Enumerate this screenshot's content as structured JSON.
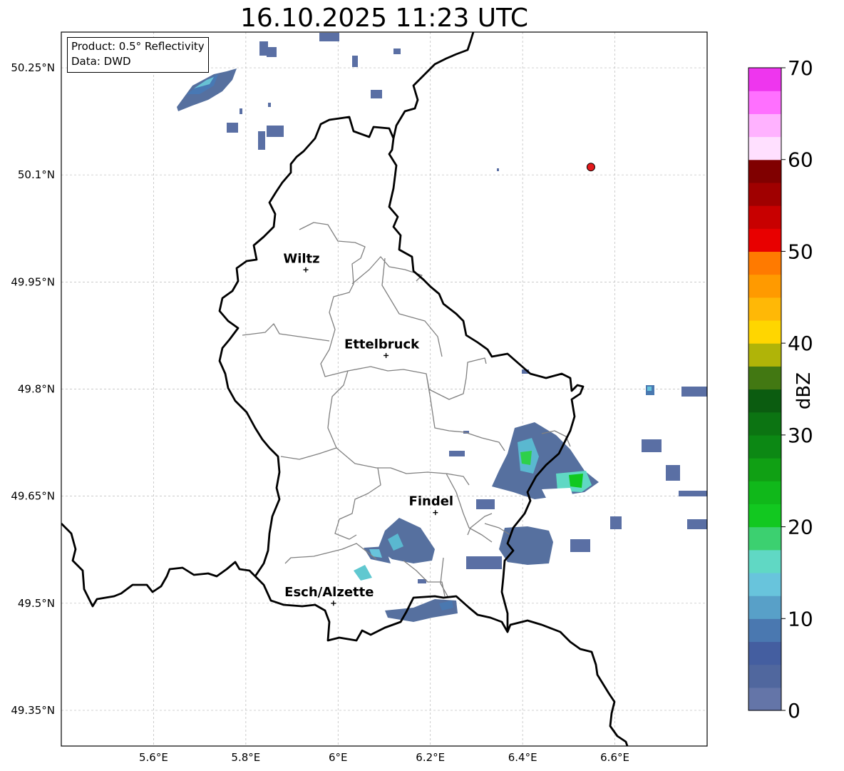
{
  "title": "16.10.2025 11:23 UTC",
  "info": {
    "product": "Product: 0.5° Reflectivity",
    "data": "Data: DWD"
  },
  "map": {
    "lon_range": [
      5.4,
      6.8
    ],
    "lat_range": [
      49.3,
      50.3
    ],
    "lon_ticks": [
      {
        "value": 5.6,
        "label": "5.6°E"
      },
      {
        "value": 5.8,
        "label": "5.8°E"
      },
      {
        "value": 6.0,
        "label": "6°E"
      },
      {
        "value": 6.2,
        "label": "6.2°E"
      },
      {
        "value": 6.4,
        "label": "6.4°E"
      },
      {
        "value": 6.6,
        "label": "6.6°E"
      }
    ],
    "lat_ticks": [
      {
        "value": 49.35,
        "label": "49.35°N"
      },
      {
        "value": 49.5,
        "label": "49.5°N"
      },
      {
        "value": 49.65,
        "label": "49.65°N"
      },
      {
        "value": 49.8,
        "label": "49.8°N"
      },
      {
        "value": 49.95,
        "label": "49.95°N"
      },
      {
        "value": 50.1,
        "label": "50.1°N"
      },
      {
        "value": 50.25,
        "label": "50.25°N"
      }
    ],
    "grid": true,
    "cities": [
      {
        "name": "Wiltz",
        "lon": 5.93,
        "lat": 49.967
      },
      {
        "name": "Ettelbruck",
        "lon": 6.104,
        "lat": 49.847
      },
      {
        "name": "Findel",
        "lon": 6.211,
        "lat": 49.627
      },
      {
        "name": "Esch/Alzette",
        "lon": 5.99,
        "lat": 49.5
      }
    ],
    "radar_site": {
      "lon": 6.548,
      "lat": 50.111,
      "color": "#e41a1c"
    }
  },
  "colorbar": {
    "unit": "dBZ",
    "min": 0,
    "max": 70,
    "tick_labels": [
      "0",
      "10",
      "20",
      "30",
      "40",
      "50",
      "60",
      "70"
    ],
    "colors": [
      "#6475a8",
      "#50679e",
      "#445ea0",
      "#4a78b0",
      "#58a0c8",
      "#68c4dc",
      "#60d8c4",
      "#3cd070",
      "#12c820",
      "#10b81a",
      "#10a014",
      "#0c8814",
      "#0c7412",
      "#0b5c10",
      "#427812",
      "#b0b408",
      "#ffd600",
      "#ffb806",
      "#ff9a00",
      "#ff7a00",
      "#e80000",
      "#c80000",
      "#a00000",
      "#800000",
      "#ffe0ff",
      "#ffb2ff",
      "#ff70ff",
      "#ee36ee"
    ]
  }
}
